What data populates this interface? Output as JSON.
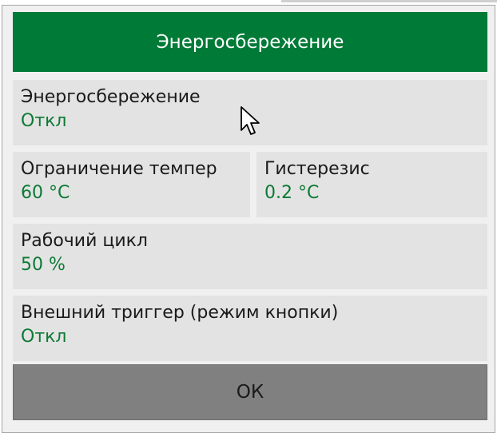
{
  "dialog": {
    "title": "Энергосбережение",
    "fields": [
      {
        "label": "Энергосбережение",
        "value": "Откл"
      },
      {
        "label": "Ограничение темпер",
        "value": "60 °C"
      },
      {
        "label": "Гистерезис",
        "value": "0.2 °C"
      },
      {
        "label": "Рабочий цикл",
        "value": "50 %"
      },
      {
        "label": "Внешний триггер (режим кнопки)",
        "value": "Откл"
      }
    ],
    "ok_label": "ОК"
  },
  "icons": {
    "cursor": "mouse-pointer-icon"
  },
  "colors": {
    "header_bg": "#007a37",
    "value_text": "#0d7a35",
    "field_bg": "#e3e3e3",
    "ok_bg": "#808080"
  }
}
